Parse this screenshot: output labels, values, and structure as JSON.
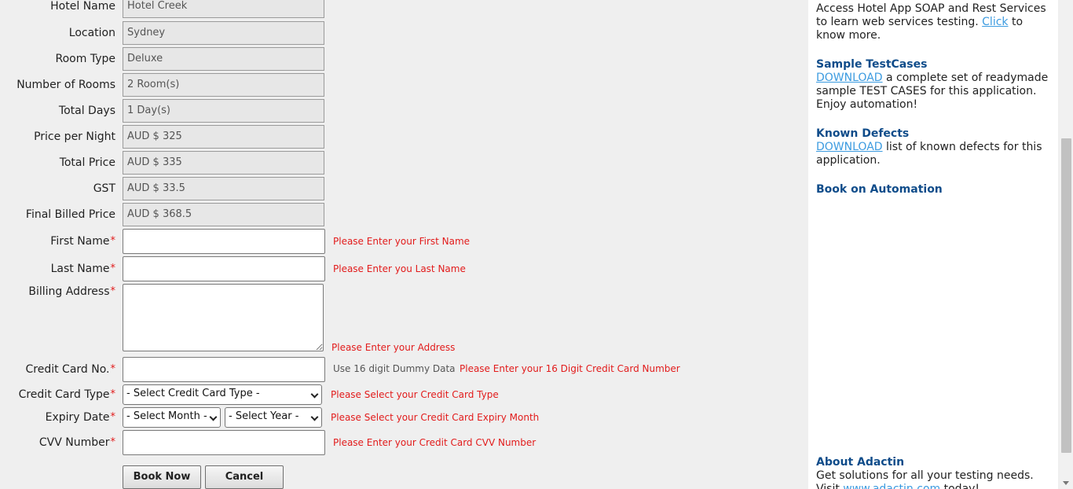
{
  "readonly_fields": [
    {
      "label": "Hotel Name",
      "value": "Hotel Creek"
    },
    {
      "label": "Location",
      "value": "Sydney"
    },
    {
      "label": "Room Type",
      "value": "Deluxe"
    },
    {
      "label": "Number of Rooms",
      "value": "2 Room(s)"
    },
    {
      "label": "Total Days",
      "value": "1 Day(s)"
    },
    {
      "label": "Price per Night",
      "value": "AUD $ 325"
    },
    {
      "label": "Total Price",
      "value": "AUD $ 335"
    },
    {
      "label": "GST",
      "value": "AUD $ 33.5"
    },
    {
      "label": "Final Billed Price",
      "value": "AUD $ 368.5"
    }
  ],
  "form": {
    "required_mark": "*",
    "first_name": {
      "label": "First Name",
      "value": "",
      "error": "Please Enter your First Name"
    },
    "last_name": {
      "label": "Last Name",
      "value": "",
      "error": "Please Enter you Last Name"
    },
    "billing_address": {
      "label": "Billing Address",
      "value": "",
      "error": "Please Enter your Address"
    },
    "cc_number": {
      "label": "Credit Card No.",
      "value": "",
      "hint": "Use 16 digit Dummy Data",
      "error": "Please Enter your 16 Digit Credit Card Number"
    },
    "cc_type": {
      "label": "Credit Card Type",
      "selected": "- Select Credit Card Type -",
      "error": "Please Select your Credit Card Type"
    },
    "expiry": {
      "label": "Expiry Date",
      "month_selected": "- Select Month -",
      "year_selected": "- Select Year -",
      "error": "Please Select your Credit Card Expiry Month"
    },
    "cvv": {
      "label": "CVV Number",
      "value": "",
      "error": "Please Enter your Credit Card CVV Number"
    },
    "book_now_label": "Book Now",
    "cancel_label": "Cancel"
  },
  "sidebar": {
    "soap_text_before": "Access Hotel App SOAP and Rest Services to learn web services testing.",
    "soap_link": "Click",
    "soap_text_after": "to know more.",
    "sample_title": "Sample TestCases",
    "sample_link": "DOWNLOAD",
    "sample_text": "a complete set of readymade sample TEST CASES for this application. Enjoy automation!",
    "defects_title": "Known Defects",
    "defects_link": "DOWNLOAD",
    "defects_text": "list of known defects for this application.",
    "book_title": "Book on Automation",
    "about_title": "About Adactin",
    "about_text": "Get solutions for all your testing needs.",
    "about_visit": "Visit",
    "about_link": "www.adactin.com",
    "about_after": "today!"
  },
  "colors": {
    "error": "#e21b1b",
    "link": "#3c9be0",
    "heading": "#0f4c8a"
  }
}
